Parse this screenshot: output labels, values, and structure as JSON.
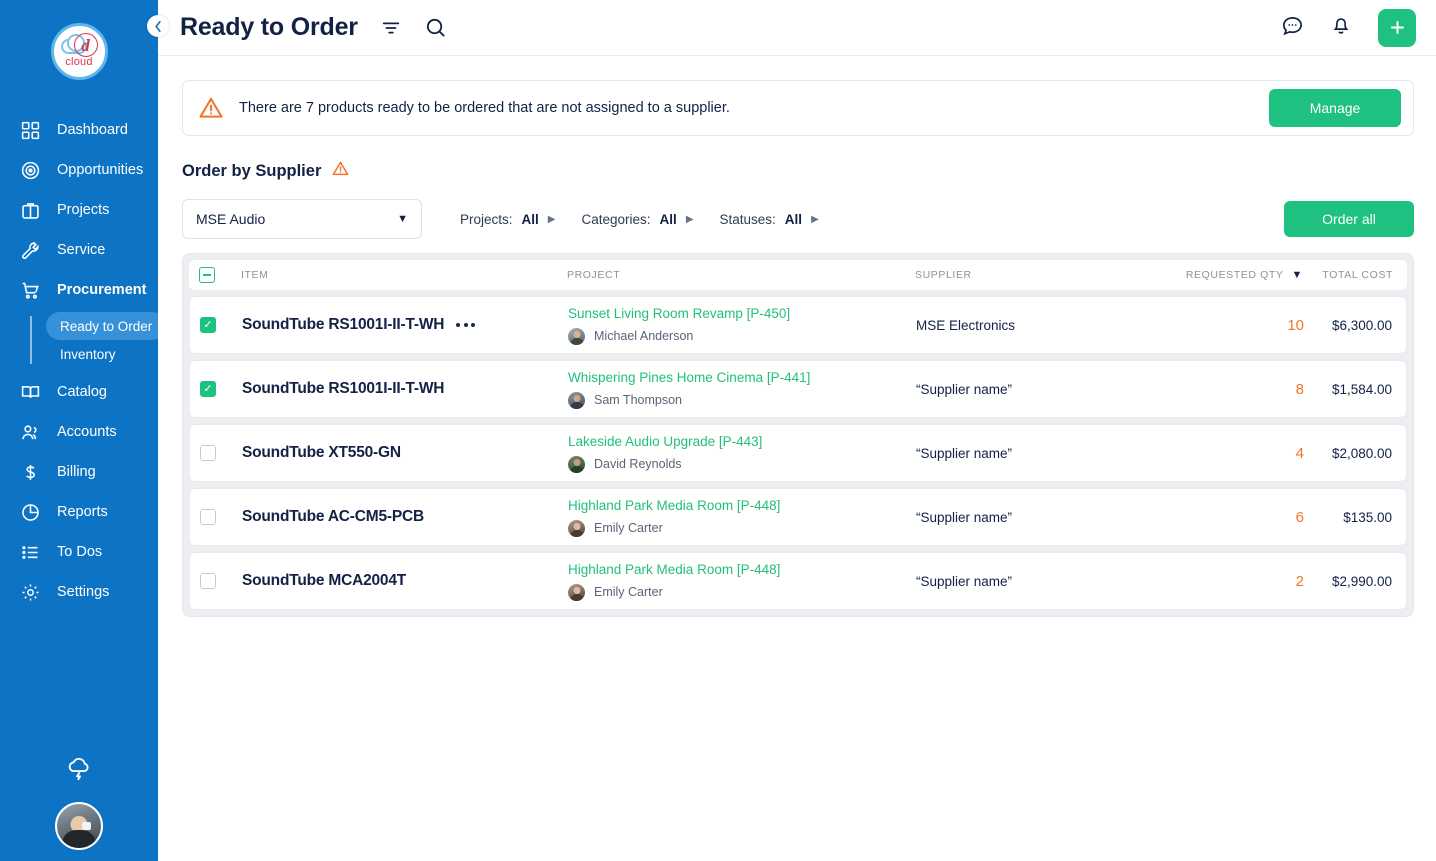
{
  "brand": {
    "logo_letter": "d",
    "logo_text": "cloud",
    "sidebar_color": "#0d73c4",
    "accent_green": "#1ec17f",
    "warning_orange": "#f2752a",
    "link_green": "#21c17a"
  },
  "topbar": {
    "collapse_icon": "chevron-left-icon",
    "title": "Ready to Order",
    "filter_icon": "filter-icon",
    "search_icon": "search-icon",
    "chat_icon": "chat-bubble-icon",
    "bell_icon": "bell-icon",
    "add_label": "+"
  },
  "sidebar": {
    "items": [
      {
        "label": "Dashboard",
        "icon": "grid-icon",
        "active": false
      },
      {
        "label": "Opportunities",
        "icon": "target-icon",
        "active": false
      },
      {
        "label": "Projects",
        "icon": "briefcase-icon",
        "active": false
      },
      {
        "label": "Service",
        "icon": "wrench-icon",
        "active": false
      },
      {
        "label": "Procurement",
        "icon": "cart-icon",
        "active": true
      },
      {
        "label": "Catalog",
        "icon": "book-icon",
        "active": false
      },
      {
        "label": "Accounts",
        "icon": "users-icon",
        "active": false
      },
      {
        "label": "Billing",
        "icon": "dollar-icon",
        "active": false
      },
      {
        "label": "Reports",
        "icon": "pie-chart-icon",
        "active": false
      },
      {
        "label": "To Dos",
        "icon": "list-icon",
        "active": false
      },
      {
        "label": "Settings",
        "icon": "gear-icon",
        "active": false
      }
    ],
    "subitems": [
      {
        "label": "Ready to Order",
        "active": true
      },
      {
        "label": "Inventory",
        "active": false
      }
    ],
    "weather_icon": "cloud-lightning-icon",
    "user_avatar": "user-avatar"
  },
  "alert": {
    "icon": "warning-triangle-icon",
    "message": "There are 7 products ready to be ordered that are not assigned to a supplier.",
    "action_label": "Manage"
  },
  "section": {
    "title": "Order by Supplier",
    "warning_icon": "warning-triangle-icon",
    "supplier_select": {
      "value": "MSE Audio",
      "caret": "▼"
    },
    "filters": [
      {
        "label": "Projects:",
        "value": "All"
      },
      {
        "label": "Categories:",
        "value": "All"
      },
      {
        "label": "Statuses:",
        "value": "All"
      }
    ],
    "order_all_label": "Order all"
  },
  "table": {
    "header_checkbox_state": "indeterminate",
    "columns": [
      {
        "key": "item",
        "label": "ITEM"
      },
      {
        "key": "project",
        "label": "PROJECT"
      },
      {
        "key": "supplier",
        "label": "SUPPLIER"
      },
      {
        "key": "qty",
        "label": "REQUESTED QTY",
        "sorted": true,
        "sort_caret": "▼"
      },
      {
        "key": "cost",
        "label": "TOTAL COST"
      }
    ],
    "rows": [
      {
        "checked": true,
        "item": "SoundTube RS1001I-II-T-WH",
        "has_menu": true,
        "menu_icon": "more-options-icon",
        "project": "Sunset Living Room Revamp [P-450]",
        "person": "Michael Anderson",
        "avatar_skin": "#d9b28f",
        "avatar_body": "#3c4a3a",
        "supplier": "MSE Electronics",
        "qty": "10",
        "cost": "$6,300.00"
      },
      {
        "checked": true,
        "item": "SoundTube RS1001I-II-T-WH",
        "has_menu": false,
        "project": "Whispering Pines Home Cinema [P-441]",
        "person": "Sam Thompson",
        "avatar_skin": "#caa586",
        "avatar_body": "#2e3a46",
        "supplier": "“Supplier name”",
        "qty": "8",
        "cost": "$1,584.00"
      },
      {
        "checked": false,
        "item": "SoundTube XT550-GN",
        "has_menu": false,
        "project": "Lakeside Audio Upgrade [P-443]",
        "person": "David Reynolds",
        "avatar_skin": "#c79c78",
        "avatar_body": "#24402a",
        "supplier": "“Supplier name”",
        "qty": "4",
        "cost": "$2,080.00"
      },
      {
        "checked": false,
        "item": "SoundTube AC-CM5-PCB",
        "has_menu": false,
        "project": "Highland Park Media Room [P-448]",
        "person": "Emily Carter",
        "avatar_skin": "#e3bb9a",
        "avatar_body": "#4a3a30",
        "supplier": "“Supplier name”",
        "qty": "6",
        "cost": "$135.00"
      },
      {
        "checked": false,
        "item": "SoundTube MCA2004T",
        "has_menu": false,
        "project": "Highland Park Media Room [P-448]",
        "person": "Emily Carter",
        "avatar_skin": "#e3bb9a",
        "avatar_body": "#4a3a30",
        "supplier": "“Supplier name”",
        "qty": "2",
        "cost": "$2,990.00"
      }
    ]
  }
}
